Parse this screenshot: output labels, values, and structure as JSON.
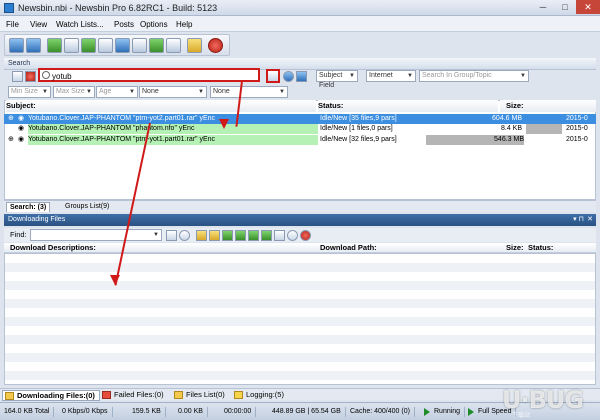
{
  "window": {
    "title": "Newsbin.nbi - Newsbin Pro 6.82RC1 - Build: 5123",
    "min": "─",
    "max": "□",
    "close": "✕"
  },
  "menu": [
    "File",
    "View",
    "Watch Lists...",
    "Posts",
    "Options",
    "Help"
  ],
  "search": {
    "panel_title": "Search",
    "query": "yotub",
    "subject_field": "Subject Field",
    "server": "Internet",
    "group_placeholder": "Search In Group/Topic",
    "min_size": "Min Size",
    "max_size": "Max Size",
    "age": "Age",
    "filter1": "None",
    "filter2": "None"
  },
  "results": {
    "col_subject": "Subject:",
    "col_status": "Status:",
    "col_size": "Size:",
    "rows": [
      {
        "subject": "Yotubano.Clover.JAP-PHANTOM  \"ptm-yot2.part01.rar\" yEnc",
        "status": "Idle/New [35 files,9 pars]",
        "size": "604.6 MB",
        "date": "2015-0"
      },
      {
        "subject": "Yotubano.Clover.JAP-PHANTOM  \"phantom.nfo\" yEnc",
        "status": "Idle/New [1 files,0 pars]",
        "size": "8.4 KB",
        "date": "2015-0"
      },
      {
        "subject": "Yotubano.Clover.JAP-PHANTOM  \"ptm-yot1.part01.rar\" yEnc",
        "status": "Idle/New [32 files,9 pars]",
        "size": "546.3 MB",
        "date": "2015-0"
      }
    ]
  },
  "tabs": {
    "search": "Search: (3)",
    "groups": "Groups List(9)"
  },
  "downloading": {
    "panel_title": "Downloading Files",
    "pin": "▾ ⊓",
    "close": "✕",
    "find_label": "Find:",
    "col_desc": "Download Descriptions:",
    "col_path": "Download Path:",
    "col_size": "Size:",
    "col_status": "Status:"
  },
  "bottom_tabs": [
    "Downloading Files:(0)",
    "Failed Files:(0)",
    "Files List(0)",
    "Logging:(5)"
  ],
  "status": {
    "total": "164.0 KB Total",
    "speed": "0 Kbps/0 Kbps",
    "a": "159.5 KB",
    "b": "0.00 KB",
    "time": "00:00:00",
    "disk": "448.89 GB | 65.54 GB",
    "cache": "Cache: 400/400 (0)",
    "running": "Running",
    "full_speed": "Full Speed"
  },
  "watermark": {
    "word": "U·BUG",
    "sub": "下载站"
  }
}
